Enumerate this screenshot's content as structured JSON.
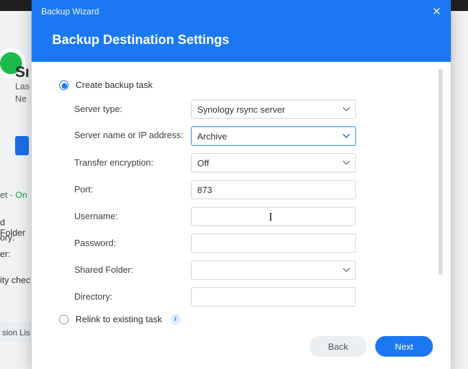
{
  "background": {
    "su": "Sı",
    "las": "Las",
    "ne": "Ne",
    "tag_et": "et",
    "tag_on": " - On",
    "rows": [
      "d Folder",
      "ory:",
      "er:",
      "ity chec"
    ],
    "slist": "sion Lis"
  },
  "modal": {
    "titlebar": "Backup Wizard",
    "close_glyph": "✕",
    "header": "Backup Destination Settings",
    "radio_create": "Create backup task",
    "radio_relink": "Relink to existing task",
    "info_glyph": "i",
    "labels": {
      "server_type": "Server type:",
      "server_name": "Server name or IP address:",
      "encryption": "Transfer encryption:",
      "port": "Port:",
      "username": "Username:",
      "password": "Password:",
      "shared_folder": "Shared Folder:",
      "directory": "Directory:"
    },
    "values": {
      "server_type": "Synology rsync server",
      "server_name": "Archive",
      "encryption": "Off",
      "port": "873",
      "username": "",
      "password": "",
      "shared_folder": "",
      "directory": ""
    },
    "buttons": {
      "back": "Back",
      "next": "Next"
    },
    "colors": {
      "primary": "#1b78f2",
      "caret_gray": "#6b7681",
      "caret_blue": "#2a7de1"
    }
  }
}
